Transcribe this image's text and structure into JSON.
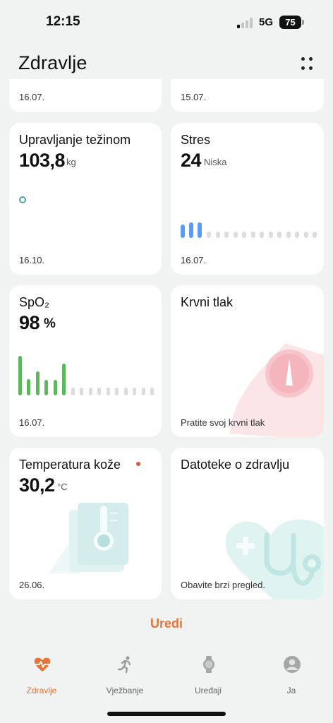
{
  "status": {
    "time": "12:15",
    "network": "5G",
    "battery": "75"
  },
  "header": {
    "title": "Zdravlje"
  },
  "top_cards": {
    "left_date": "16.07.",
    "right_date": "15.07."
  },
  "cards": {
    "weight": {
      "title": "Upravljanje težinom",
      "value": "103,8",
      "unit": "kg",
      "date": "16.10."
    },
    "stress": {
      "title": "Stres",
      "value": "24",
      "unit": "Niska",
      "date": "16.07.",
      "bar_color": "#5b9bf0"
    },
    "spo2": {
      "title": "SpO₂",
      "value": "98",
      "unit": "%",
      "date": "16.07.",
      "bar_color": "#5cb85c"
    },
    "blood_pressure": {
      "title": "Krvni tlak",
      "subtitle": "Pratite svoj krvni tlak"
    },
    "skin_temp": {
      "title": "Temperatura kože",
      "value": "30,2",
      "unit": "°C",
      "date": "26.06."
    },
    "health_files": {
      "title": "Datoteke o zdravlju",
      "subtitle": "Obavite brzi pregled."
    }
  },
  "edit_label": "Uredi",
  "tabs": [
    {
      "label": "Zdravlje",
      "icon": "heart-pulse-icon"
    },
    {
      "label": "Vježbanje",
      "icon": "running-icon"
    },
    {
      "label": "Uređaji",
      "icon": "watch-icon"
    },
    {
      "label": "Ja",
      "icon": "profile-icon"
    }
  ],
  "accent_color": "#e8743b"
}
